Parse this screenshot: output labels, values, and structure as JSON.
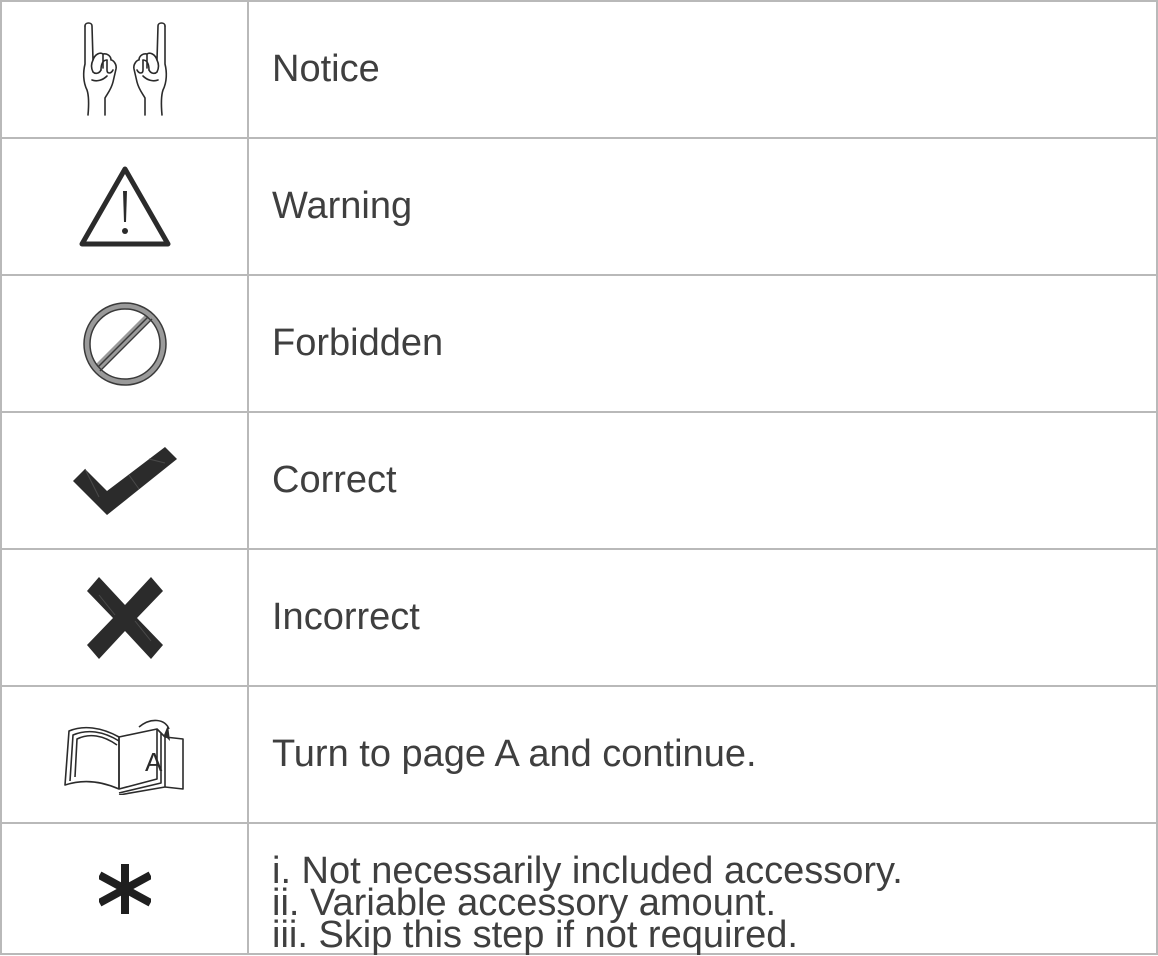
{
  "legend": {
    "rows": [
      {
        "icon": "raised-fingers-icon",
        "label": "Notice"
      },
      {
        "icon": "warning-triangle-icon",
        "label": "Warning"
      },
      {
        "icon": "forbidden-icon",
        "label": "Forbidden"
      },
      {
        "icon": "checkmark-icon",
        "label": "Correct"
      },
      {
        "icon": "cross-icon",
        "label": "Incorrect"
      },
      {
        "icon": "open-book-page-icon",
        "label": "Turn to page A and continue.",
        "icon_text": "A"
      },
      {
        "icon": "asterisk-icon",
        "lines": [
          "i. Not necessarily included accessory.",
          "ii. Variable accessory amount.",
          "iii. Skip this step if not required."
        ]
      }
    ]
  },
  "colors": {
    "border": "#b9b9b9",
    "text": "#3f3f3f",
    "icon": "#2b2b2b",
    "forbidden": "#9a9a9a"
  }
}
